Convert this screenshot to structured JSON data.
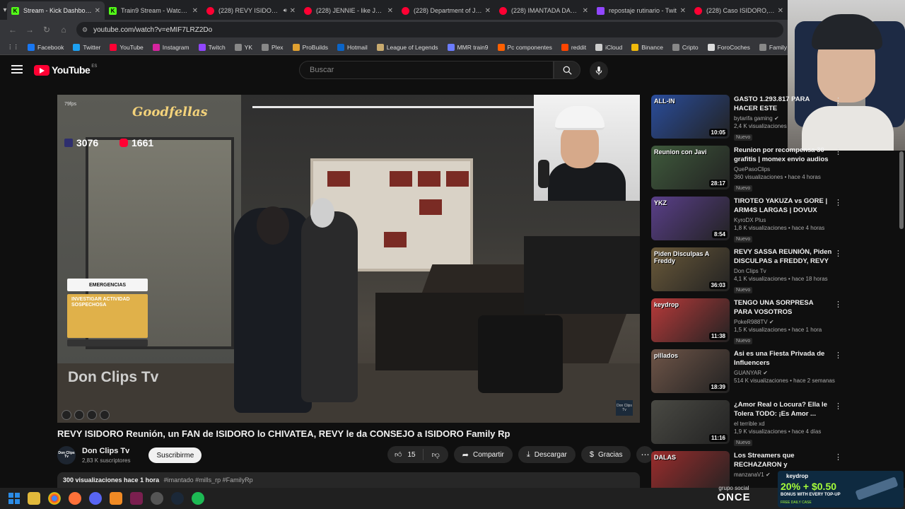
{
  "tabs": [
    {
      "title": "Stream - Kick Dashboard",
      "icon": "kick-icon",
      "active": true
    },
    {
      "title": "Train9 Stream - Watch Liv",
      "icon": "kick-icon"
    },
    {
      "title": "(228) REVY ISIDORO R",
      "icon": "youtube-icon",
      "audio": true
    },
    {
      "title": "(228) JENNIE - like JENNIE",
      "icon": "youtube-icon"
    },
    {
      "title": "(228) Department of Just",
      "icon": "youtube-icon"
    },
    {
      "title": "(228) IMANTADA DAL ULTI",
      "icon": "youtube-icon"
    },
    {
      "title": "repostaje rutinario - Twit",
      "icon": "twitch-icon"
    },
    {
      "title": "(228) Caso ISIDORO, INTI",
      "icon": "youtube-icon"
    }
  ],
  "url": "youtube.com/watch?v=eMIF7LRZ2Do",
  "bookmarks": [
    {
      "label": "Facebook",
      "color": "#1877f2"
    },
    {
      "label": "Twitter",
      "color": "#1da1f2"
    },
    {
      "label": "YouTube",
      "color": "#ff0033"
    },
    {
      "label": "Instagram",
      "color": "#d6249f"
    },
    {
      "label": "Twitch",
      "color": "#9146ff"
    },
    {
      "label": "YK",
      "color": "#888888"
    },
    {
      "label": "Plex",
      "color": "#888888"
    },
    {
      "label": "ProBuilds",
      "color": "#e0a030"
    },
    {
      "label": "Hotmail",
      "color": "#0a64c8"
    },
    {
      "label": "League of Legends",
      "color": "#c8aa6e"
    },
    {
      "label": "MMR train9",
      "color": "#6b7cff"
    },
    {
      "label": "Pc componentes",
      "color": "#ff6000"
    },
    {
      "label": "reddit",
      "color": "#ff4500"
    },
    {
      "label": "iCloud",
      "color": "#cccccc"
    },
    {
      "label": "Binance",
      "color": "#f0b90b"
    },
    {
      "label": "Cripto",
      "color": "#888888"
    },
    {
      "label": "ForoCoches",
      "color": "#dddddd"
    },
    {
      "label": "Family",
      "color": "#888888"
    }
  ],
  "youtube": {
    "logo_text": "YouTube",
    "region": "ES",
    "search_placeholder": "Buscar"
  },
  "video": {
    "overlay": {
      "brand": "Goodfellas",
      "kick_count": "3076",
      "yt_count": "1661",
      "fps": "79fps",
      "hud_title": "EMERGENCIAS",
      "hud_task": "INVESTIGAR ACTIVIDAD SOSPECHOSA",
      "watermark": "Don Clips Tv",
      "corner_logo": "Don Clips Tv"
    },
    "title": "REVY ISIDORO Reunión, un FAN de ISIDORO lo CHIVATEA, REVY le da CONSEJO a ISIDORO Family Rp",
    "channel": {
      "name": "Don Clips Tv",
      "subs": "2,83 K suscriptores",
      "avatar_text": "Don Clips Tv"
    },
    "subscribe_label": "Suscribirme",
    "likes": "15",
    "share_label": "Compartir",
    "download_label": "Descargar",
    "thanks_label": "Gracias",
    "views_time": "300 visualizaciones  hace 1 hora",
    "hashtags": "#imantado #mills_rp #FamilyRp"
  },
  "recommendations": [
    {
      "title": "GASTO 1.293.817 PARA HACER ESTE",
      "channel": "bytarifa gaming",
      "verified": true,
      "views": "2,4 K visualizaciones",
      "badge": "Nuevo",
      "duration": "10:05",
      "thumb_caption": "ALL-IN",
      "thumb_color": "#2a4d9c"
    },
    {
      "title": "Reunion por recompensa 30 grafitis | momex envio audios ...",
      "channel": "QuePasoClips",
      "verified": false,
      "views": "360 visualizaciones • hace 4 horas",
      "badge": "Nuevo",
      "duration": "28:17",
      "thumb_caption": "Reunion con Javi",
      "thumb_color": "#3f5a3c"
    },
    {
      "title": "TIROTEO YAKUZA vs GORE | ARM4S LARGAS | DOVUX LIFE...",
      "channel": "KyroDX Plus",
      "verified": false,
      "views": "1,8 K visualizaciones • hace 4 horas",
      "badge": "Nuevo",
      "duration": "8:54",
      "thumb_caption": "YKZ",
      "thumb_color": "#5a3f8a"
    },
    {
      "title": "REVY SASSA REUNIÓN, Piden DISCULPAS a FREDDY, REVY ...",
      "channel": "Don Clips Tv",
      "verified": false,
      "views": "4,1 K visualizaciones • hace 18 horas",
      "badge": "Nuevo",
      "duration": "36:03",
      "thumb_caption": "Piden Disculpas A Freddy",
      "thumb_color": "#6b5a3a"
    },
    {
      "title": "TENGO UNA SORPRESA PARA VOSOTROS",
      "channel": "PokeR988TV",
      "verified": true,
      "views": "1,5 K visualizaciones • hace 1 hora",
      "badge": "Nuevo",
      "duration": "11:38",
      "thumb_caption": "keydrop",
      "thumb_color": "#b83a3a"
    },
    {
      "title": "Asi es una Fiesta Privada de Influencers",
      "channel": "GUANYAR",
      "verified": true,
      "views": "514 K visualizaciones • hace 2 semanas",
      "badge": "",
      "duration": "18:39",
      "thumb_caption": "pillados",
      "thumb_color": "#6f5548"
    },
    {
      "title": "¿Amor Real o Locura? Ella le Tolera TODO: ¡Es Amor ...",
      "channel": "el terrible xd",
      "verified": false,
      "views": "1,9 K visualizaciones • hace 4 días",
      "badge": "Nuevo",
      "duration": "11:16",
      "thumb_caption": "",
      "thumb_color": "#4a4a44"
    },
    {
      "title": "Los Streamers que RECHAZARON y EXPUSIERON...",
      "channel": "manzanaV1",
      "verified": true,
      "views": "",
      "badge": "",
      "duration": "",
      "thumb_caption": "DALAS",
      "thumb_color": "#9a2c2c"
    }
  ],
  "taskbar": [
    "windows-start",
    "file-explorer",
    "chrome",
    "firefox",
    "discord",
    "vlc",
    "nextcloud",
    "settings",
    "steam",
    "spotify"
  ],
  "sponsor_once": {
    "line1": "grupo social",
    "line2": "ONCE"
  },
  "sponsor_keydrop": {
    "brand": "keydrop",
    "offer": "20% + $0.50",
    "sub": "BONUS WITH EVERY TOP-UP",
    "free": "FREE DAILY CASE"
  }
}
